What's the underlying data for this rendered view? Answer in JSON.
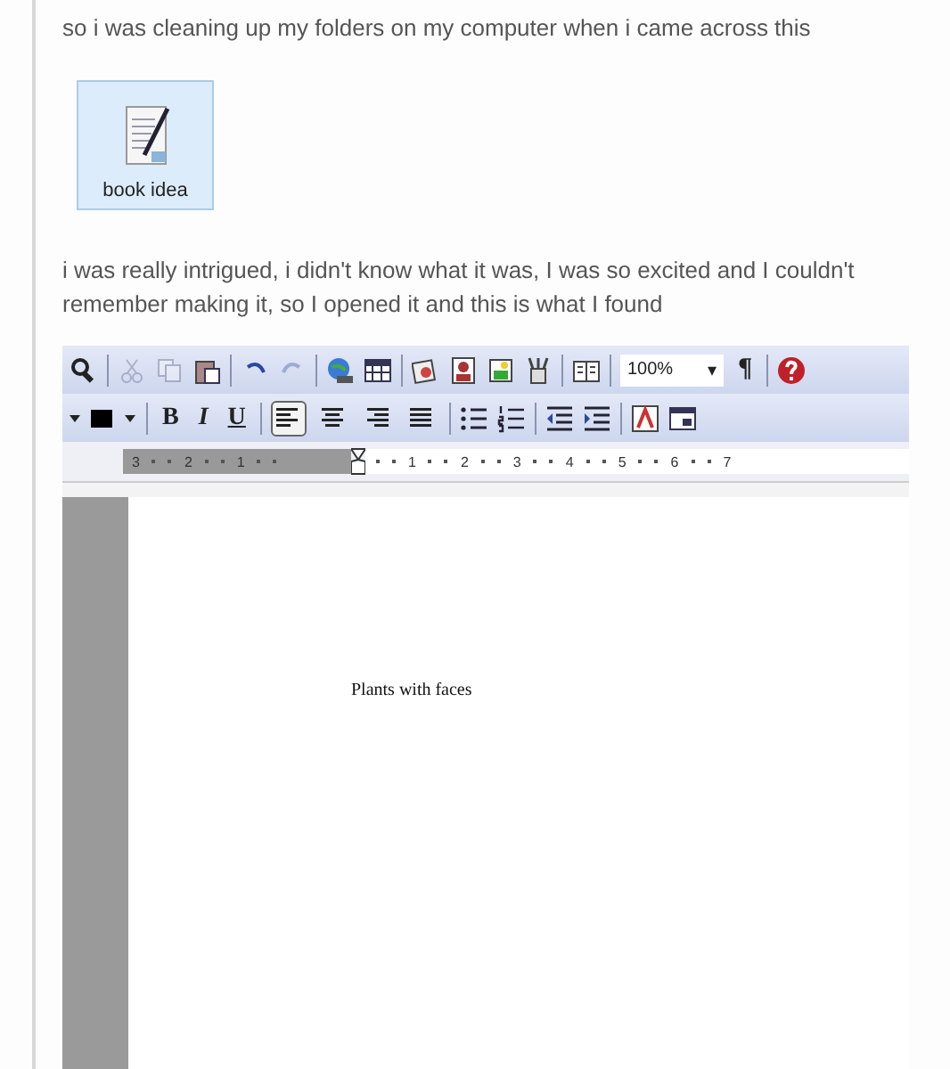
{
  "post": {
    "intro": "so i was cleaning up my folders on my computer when i came across this",
    "file": {
      "name": "book idea",
      "selected": true
    },
    "story": "i was really intrigued, i didn't know what it was, I was so excited and I couldn't remember making it, so I opened it and this is what I found"
  },
  "word": {
    "standard_toolbar": [
      {
        "kind": "preview",
        "disabled": false
      },
      {
        "kind": "sep"
      },
      {
        "kind": "cut",
        "disabled": true
      },
      {
        "kind": "copy",
        "disabled": true
      },
      {
        "kind": "paste",
        "disabled": false
      },
      {
        "kind": "sep"
      },
      {
        "kind": "undo",
        "disabled": false
      },
      {
        "kind": "redo",
        "disabled": true
      },
      {
        "kind": "sep"
      },
      {
        "kind": "hyperlink",
        "disabled": false
      },
      {
        "kind": "table",
        "disabled": false
      },
      {
        "kind": "sep"
      },
      {
        "kind": "clipart",
        "disabled": false
      },
      {
        "kind": "person",
        "disabled": false
      },
      {
        "kind": "image",
        "disabled": false
      },
      {
        "kind": "drawing",
        "disabled": false
      },
      {
        "kind": "sep"
      },
      {
        "kind": "book",
        "disabled": false
      },
      {
        "kind": "sep"
      }
    ],
    "zoom": "100%",
    "zoom_caret": "▾",
    "pilcrow": "¶",
    "formatting_toolbar": {
      "bold": "B",
      "italic": "I",
      "underline": "U",
      "alignments": [
        {
          "kind": "left",
          "selected": true
        },
        {
          "kind": "center",
          "selected": false
        },
        {
          "kind": "right",
          "selected": false
        },
        {
          "kind": "justify",
          "selected": false
        }
      ]
    },
    "ruler": {
      "left_labels": [
        "3",
        "2",
        "1"
      ],
      "right_labels": [
        "1",
        "2",
        "3",
        "4",
        "5",
        "6",
        "7"
      ]
    },
    "document": {
      "text": "Plants with faces"
    }
  }
}
